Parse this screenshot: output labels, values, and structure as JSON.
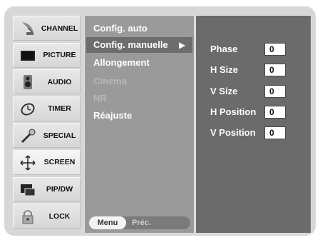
{
  "sidebar": {
    "items": [
      {
        "label": "CHANNEL",
        "icon": "satellite-dish-icon"
      },
      {
        "label": "PICTURE",
        "icon": "monitor-icon"
      },
      {
        "label": "AUDIO",
        "icon": "speaker-icon"
      },
      {
        "label": "TIMER",
        "icon": "clock-icon"
      },
      {
        "label": "SPECIAL",
        "icon": "wand-icon"
      },
      {
        "label": "SCREEN",
        "icon": "move-arrows-icon"
      },
      {
        "label": "PIP/DW",
        "icon": "pip-icon"
      },
      {
        "label": "LOCK",
        "icon": "padlock-icon"
      }
    ],
    "active": "SCREEN"
  },
  "screen_menu": {
    "items": [
      "Config. auto",
      "Config. manuelle",
      "Allongement",
      "Cinema",
      "NR",
      "Réajuste"
    ],
    "selected": "Config. manuelle",
    "disabled": [
      "Cinema",
      "NR"
    ],
    "arrow": "▶",
    "footer": {
      "menu_label": "Menu",
      "back_label": "Préc."
    }
  },
  "manual_config": {
    "rows": [
      {
        "label": "Phase",
        "value": "0"
      },
      {
        "label": "H Size",
        "value": "0"
      },
      {
        "label": "V Size",
        "value": "0"
      },
      {
        "label": "H Position",
        "value": "0"
      },
      {
        "label": "V Position",
        "value": "0"
      }
    ]
  },
  "colors": {
    "panel": "#d7d7d7",
    "menu_bg": "#9a9a9a",
    "submenu_bg": "#6b6b6b",
    "highlight": "#6d6d6d"
  }
}
